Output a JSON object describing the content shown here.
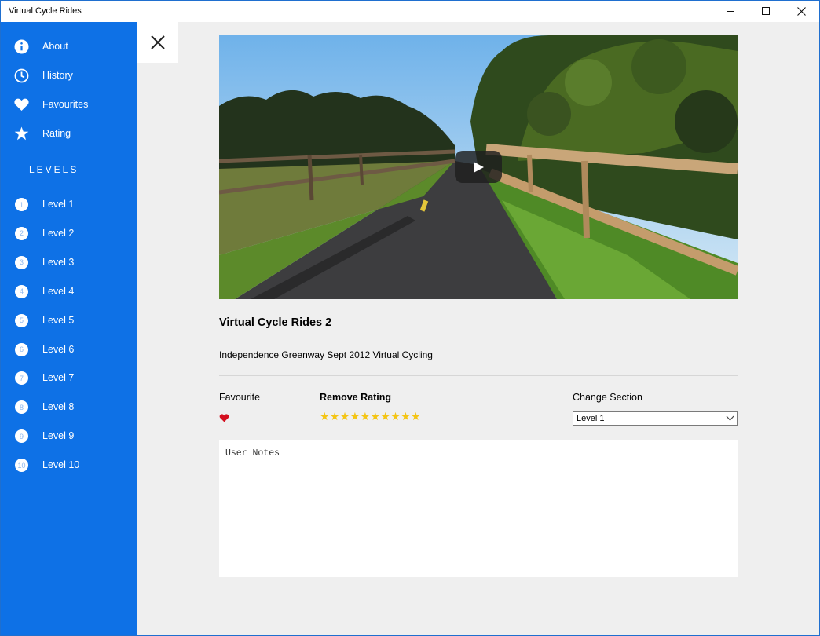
{
  "window": {
    "title": "Virtual Cycle Rides"
  },
  "sidebar": {
    "items": [
      {
        "label": "About",
        "icon": "info-icon"
      },
      {
        "label": "History",
        "icon": "clock-icon"
      },
      {
        "label": "Favourites",
        "icon": "heart-icon"
      },
      {
        "label": "Rating",
        "icon": "star-icon"
      }
    ],
    "levels_header": "LEVELS",
    "levels": [
      {
        "num": "1",
        "label": "Level 1"
      },
      {
        "num": "2",
        "label": "Level 2"
      },
      {
        "num": "3",
        "label": "Level 3"
      },
      {
        "num": "4",
        "label": "Level 4"
      },
      {
        "num": "5",
        "label": "Level 5"
      },
      {
        "num": "6",
        "label": "Level 6"
      },
      {
        "num": "7",
        "label": "Level 7"
      },
      {
        "num": "8",
        "label": "Level 8"
      },
      {
        "num": "9",
        "label": "Level 9"
      },
      {
        "num": "10",
        "label": "Level 10"
      }
    ]
  },
  "video": {
    "title": "Virtual Cycle Rides 2",
    "description": "Independence Greenway Sept 2012 Virtual Cycling"
  },
  "details": {
    "favourite_label": "Favourite",
    "rating_label": "Remove Rating",
    "rating": 10,
    "rating_max": 10,
    "section_label": "Change Section",
    "section_value": "Level 1"
  },
  "notes": {
    "placeholder": "User Notes"
  },
  "colors": {
    "accent": "#0e71e6",
    "star": "#f4c514",
    "heart": "#e81123",
    "background": "#efefef"
  }
}
